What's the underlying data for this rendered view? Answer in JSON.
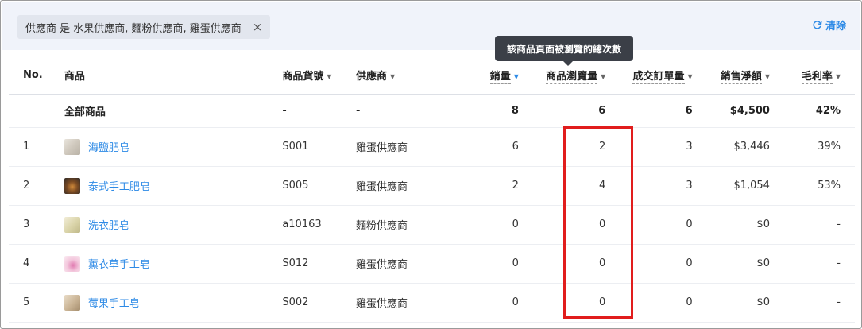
{
  "filter": {
    "chip_text": "供應商 是 水果供應商, 麵粉供應商, 雞蛋供應商",
    "close_glyph": "×"
  },
  "clear_label": "清除",
  "tooltip": "該商品頁面被瀏覽的總次數",
  "colors": {
    "accent": "#2d8ae6",
    "highlight": "#e11d1d",
    "tooltip_bg": "#3b3f47"
  },
  "columns": {
    "no": "No.",
    "product": "商品",
    "sku": "商品貨號",
    "supplier": "供應商",
    "sales": "銷量",
    "views": "商品瀏覽量",
    "orders": "成交訂單量",
    "net_sales": "銷售淨額",
    "margin": "毛利率"
  },
  "summary": {
    "label": "全部商品",
    "sku": "-",
    "supplier": "-",
    "sales": "8",
    "views": "6",
    "orders": "6",
    "net_sales": "$4,500",
    "margin": "42%"
  },
  "rows": [
    {
      "no": "1",
      "name": "海鹽肥皂",
      "sku": "S001",
      "supplier": "雞蛋供應商",
      "sales": "6",
      "views": "2",
      "orders": "3",
      "net_sales": "$3,446",
      "margin": "39%"
    },
    {
      "no": "2",
      "name": "泰式手工肥皂",
      "sku": "S005",
      "supplier": "雞蛋供應商",
      "sales": "2",
      "views": "4",
      "orders": "3",
      "net_sales": "$1,054",
      "margin": "53%"
    },
    {
      "no": "3",
      "name": "洗衣肥皂",
      "sku": "a10163",
      "supplier": "麵粉供應商",
      "sales": "0",
      "views": "0",
      "orders": "0",
      "net_sales": "$0",
      "margin": "-"
    },
    {
      "no": "4",
      "name": "薰衣草手工皂",
      "sku": "S012",
      "supplier": "雞蛋供應商",
      "sales": "0",
      "views": "0",
      "orders": "0",
      "net_sales": "$0",
      "margin": "-"
    },
    {
      "no": "5",
      "name": "莓果手工皂",
      "sku": "S002",
      "supplier": "雞蛋供應商",
      "sales": "0",
      "views": "0",
      "orders": "0",
      "net_sales": "$0",
      "margin": "-"
    }
  ]
}
